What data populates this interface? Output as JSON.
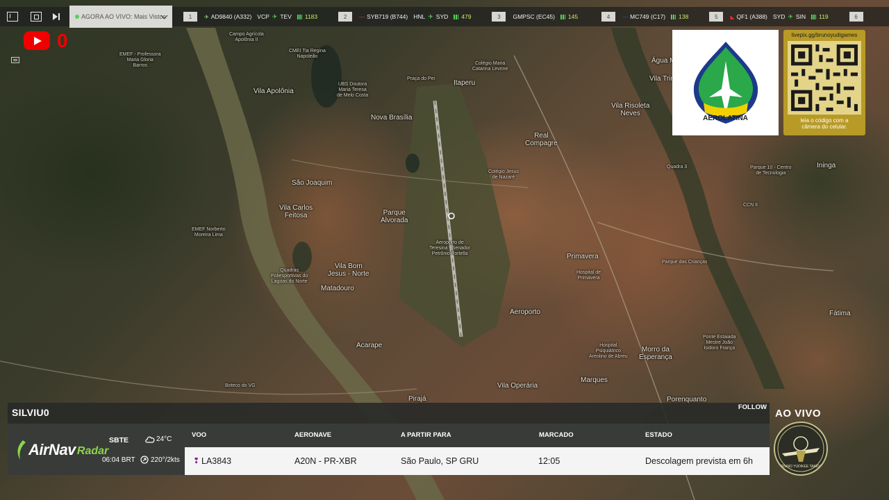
{
  "topbar": {
    "live_selector": "AGORA AO VIVO: Mais Vistos",
    "flights": [
      {
        "rank": "1",
        "callsign": "AD9840 (A332)",
        "origin": "VCP",
        "destination": "TEV",
        "viewers": "1183"
      },
      {
        "rank": "2",
        "callsign": "SYB719 (B744)",
        "origin": "HNL",
        "destination": "SYD",
        "viewers": "479"
      },
      {
        "rank": "3",
        "callsign": "GMPSC (EC45)",
        "origin": "",
        "destination": "",
        "viewers": "145"
      },
      {
        "rank": "4",
        "callsign": "MC749 (C17)",
        "origin": "",
        "destination": "",
        "viewers": "138"
      },
      {
        "rank": "5",
        "callsign": "QF1 (A388)",
        "origin": "SYD",
        "destination": "SIN",
        "viewers": "119"
      },
      {
        "rank": "6",
        "callsign": "",
        "origin": "",
        "destination": "",
        "viewers": ""
      }
    ]
  },
  "youtube": {
    "count": "0"
  },
  "map": {
    "places": {
      "campo_agricola": "Campo Agrícola\nApolônia II",
      "cmei_tia_regina": "CMEI Tia Regina\nNapoleão",
      "emef_maria_gloria": "EMEF - Professora\nMaria Gloria\nBarros",
      "vila_apolonia": "Vila Apolônia",
      "ubs_dr_maria": "UBS Doutora\nMaria Teresa\nde Melo Costa",
      "praca_do_pei": "Praça do Pei",
      "itaperu": "Itaperu",
      "colegio_catarina": "Colégio Maria\nCatarina Levrine",
      "nova_brasilia": "Nova Brasília",
      "agua_mineral": "Água Mine",
      "vila_trindade": "Vila Trinda",
      "vila_risoleta": "Vila Risoleta\nNeves",
      "real_compagre": "Real\nCompagre",
      "colegio_jesus": "Colégio Jesus\nde Nazaré",
      "sao_joaquim": "São Joaquim",
      "vila_carlos_feitosa": "Vila Carlos\nFeitosa",
      "parque_alvorada": "Parque\nAlvorada",
      "emef_norberto": "EMEF Norberto\nMoreira Lima",
      "aeroporto": "Aeroporto de\nTeresina - Senador\nPetrônio Portella",
      "primavera": "Primavera",
      "vila_bom_jesus": "Vila Bom\nJesus - Norte",
      "matadouro": "Matadouro",
      "quadras": "Quadras\nPoliesportivas do\nLagoas do Norte",
      "hospital_primavera": "Hospital de\nPrimavera",
      "parque_criancas": "Parque das Crianças",
      "aeroporto_bairro": "Aeroporto",
      "acarape": "Acarape",
      "hospital_areolino": "Hospital\nPsiquiátrico\nAreolino de Abreu",
      "morro_esperanca": "Morro da\nEsperança",
      "ponte_estaiada": "Ponte Estaiada\nMestre João\nIsidoro França",
      "fatima": "Fátima",
      "marques": "Marques",
      "vila_operaria": "Vila Operária",
      "pirajá": "Pirajá",
      "porenquanto": "Porenquanto",
      "boteco": "Boteco do VG",
      "parque10": "Parque 10 - Centro\nde Tecnologia",
      "ccn": "CCN II",
      "ininga": "Ininga",
      "quadra3": "Quadra 3"
    }
  },
  "logo": {
    "name": "AEROLATINA"
  },
  "qr": {
    "url": "livepix.gg/brunoyudigames",
    "caption": "leia o código com a\ncâmera do celular."
  },
  "panel": {
    "user": "SILVIU0",
    "follow": "FOLLOW",
    "brand_air": "AirNav",
    "brand_radar": "Radar",
    "weather": {
      "station": "SBTE",
      "time": "06:04 BRT",
      "temp": "24°C",
      "wind": "220°/2kts"
    },
    "headers": {
      "flight": "VOO",
      "aircraft": "AERONAVE",
      "route": "A PARTIR PARA",
      "scheduled": "MARCADO",
      "status": "ESTADO"
    },
    "row": {
      "flight": "LA3843",
      "aircraft": "A20N - PR-XBR",
      "route": "São Paulo, SP GRU",
      "scheduled": "12:05",
      "status": "Descolagem prevista em 6h"
    }
  },
  "ao_vivo": "AO VIVO",
  "badge": {
    "text": "BRUNO YUDIKEE TAKIDA"
  },
  "colors": {
    "youtube_red": "#f00000",
    "accent_green": "#57d35c",
    "airnav_green": "#8bd64c",
    "qr_gold": "#b89b26"
  }
}
